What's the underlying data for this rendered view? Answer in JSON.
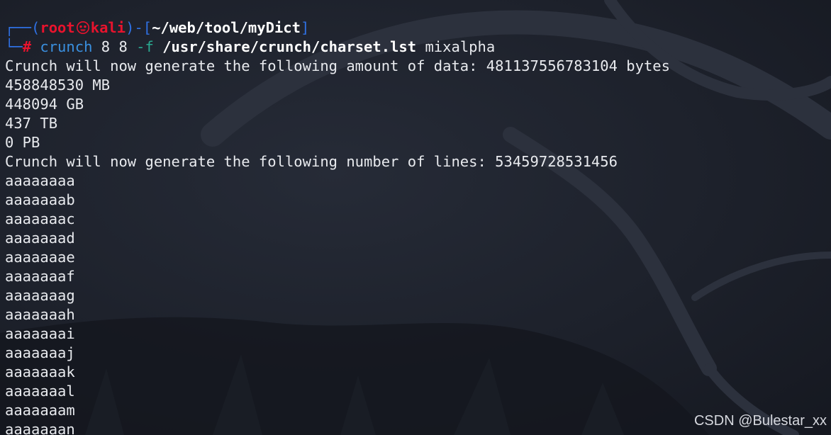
{
  "prompt": {
    "corner_top": "┌──(",
    "user": "root",
    "skull_icon": "skull-icon",
    "host": "kali",
    "dir_open": ")-[",
    "cwd": "~/web/tool/myDict",
    "dir_close": "]",
    "corner_bottom": "└─",
    "hash": "#",
    "command": "crunch",
    "args": "8 8",
    "flag": "-f",
    "charset_path": "/usr/share/crunch/charset.lst",
    "charset_name": "mixalpha"
  },
  "output": [
    "Crunch will now generate the following amount of data: 481137556783104 bytes",
    "458848530 MB",
    "448094 GB",
    "437 TB",
    "0 PB",
    "Crunch will now generate the following number of lines: 53459728531456",
    "aaaaaaaa",
    "aaaaaaab",
    "aaaaaaac",
    "aaaaaaad",
    "aaaaaaae",
    "aaaaaaaf",
    "aaaaaaag",
    "aaaaaaah",
    "aaaaaaai",
    "aaaaaaaj",
    "aaaaaaak",
    "aaaaaaal",
    "aaaaaaam",
    "aaaaaaan"
  ],
  "watermark": "CSDN @Bulestar_xx",
  "colors": {
    "background": "#1d212b",
    "prompt_frame": "#2f71e4",
    "user_host": "#e8132d",
    "command": "#3a90e0",
    "flag": "#2aa890",
    "text": "#e8eaee"
  }
}
